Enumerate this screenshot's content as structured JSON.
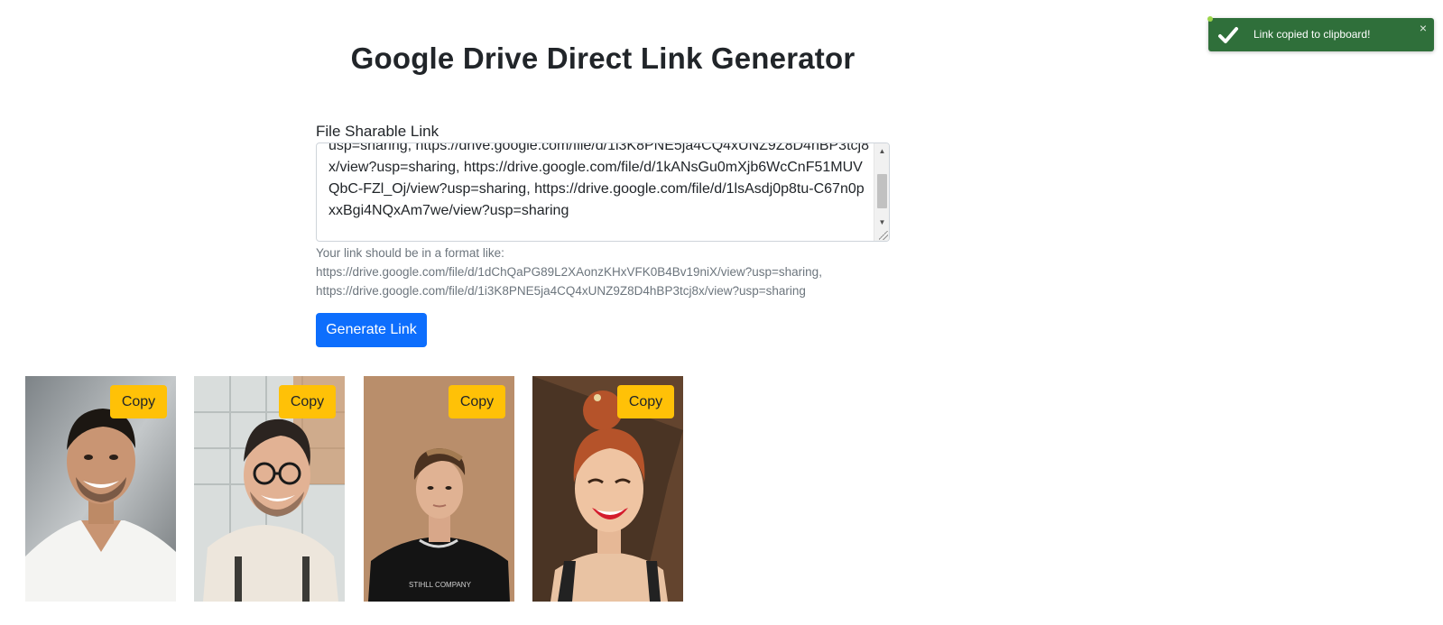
{
  "page": {
    "title": "Google Drive Direct Link Generator"
  },
  "form": {
    "field_label": "File Sharable Link",
    "textarea_value": "usp=sharing, https://drive.google.com/file/d/1i3K8PNE5ja4CQ4xUNZ9Z8D4hBP3tcj8x/view?usp=sharing, https://drive.google.com/file/d/1kANsGu0mXjb6WcCnF51MUVQbC-FZl_Oj/view?usp=sharing, https://drive.google.com/file/d/1lsAsdj0p8tu-C67n0pxxBgi4NQxAm7we/view?usp=sharing",
    "help_line_1": "Your link should be in a format like:",
    "help_line_2": "https://drive.google.com/file/d/1dChQaPG89L2XAonzKHxVFK0B4Bv19niX/view?usp=sharing,",
    "help_line_3": "https://drive.google.com/file/d/1i3K8PNE5ja4CQ4xUNZ9Z8D4hBP3tcj8x/view?usp=sharing",
    "generate_label": "Generate Link"
  },
  "results": [
    {
      "copy_label": "Copy",
      "photo_desc": "man-white-vneck"
    },
    {
      "copy_label": "Copy",
      "photo_desc": "man-glasses-smiling"
    },
    {
      "copy_label": "Copy",
      "photo_desc": "young-man-black-tshirt"
    },
    {
      "copy_label": "Copy",
      "photo_desc": "redhead-woman-smiling"
    }
  ],
  "toast": {
    "message": "Link copied to clipboard!",
    "close_glyph": "×",
    "icon": "check-icon",
    "color": "#2f6f3a"
  },
  "colors": {
    "primary": "#0d6efd",
    "warning": "#ffc107"
  }
}
